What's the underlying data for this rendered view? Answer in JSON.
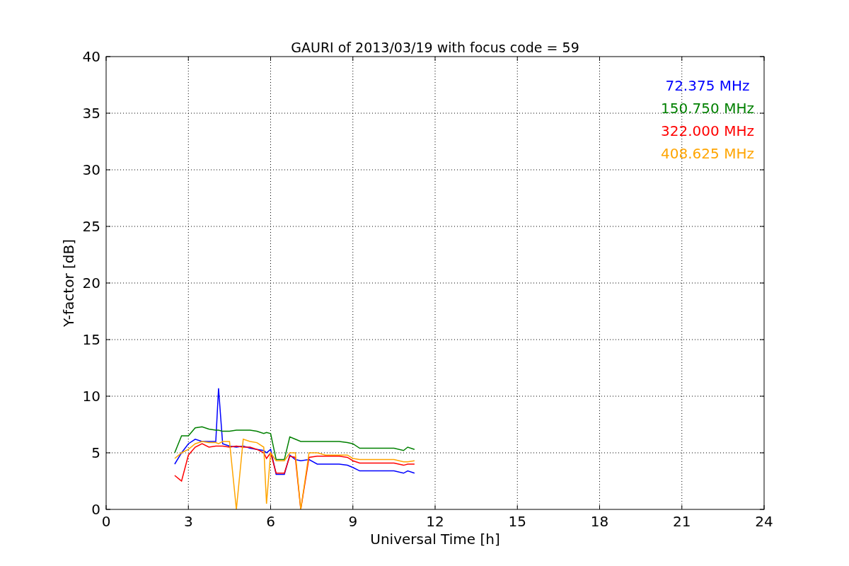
{
  "chart_data": {
    "type": "line",
    "title": "GAURI of 2013/03/19 with focus code = 59",
    "xlabel": "Universal Time [h]",
    "ylabel": "Y-factor [dB]",
    "x": [
      2.5,
      2.75,
      3,
      3.25,
      3.5,
      3.75,
      4,
      4.1,
      4.25,
      4.5,
      4.75,
      5,
      5.25,
      5.5,
      5.75,
      5.85,
      6,
      6.2,
      6.5,
      6.7,
      6.9,
      7.1,
      7.4,
      7.7,
      8,
      8.5,
      8.8,
      9,
      9.25,
      9.5,
      10,
      10.5,
      10.85,
      11,
      11.25
    ],
    "series": [
      {
        "name": "72.375 MHz",
        "color": "#0000ff",
        "values": [
          4,
          5,
          5.8,
          6.2,
          6,
          6,
          6,
          10.7,
          5.8,
          5.6,
          5.5,
          5.6,
          5.4,
          5.3,
          5.2,
          5,
          5.3,
          3.1,
          3.1,
          4.8,
          4.4,
          4.3,
          4.4,
          4,
          4,
          4,
          3.9,
          3.7,
          3.4,
          3.4,
          3.4,
          3.4,
          3.2,
          3.4,
          3.2
        ]
      },
      {
        "name": "150.750 MHz",
        "color": "#008000",
        "values": [
          5,
          6.5,
          6.5,
          7.2,
          7.3,
          7.1,
          7,
          7,
          6.9,
          6.9,
          7,
          7,
          7,
          6.9,
          6.7,
          6.8,
          6.7,
          4.4,
          4.4,
          6.4,
          6.2,
          6,
          6,
          6,
          6,
          6,
          5.9,
          5.8,
          5.4,
          5.4,
          5.4,
          5.4,
          5.2,
          5.5,
          5.3
        ]
      },
      {
        "name": "322.000 MHz",
        "color": "#ff0000",
        "values": [
          3,
          2.5,
          4.8,
          5.5,
          5.8,
          5.5,
          5.6,
          5.6,
          5.6,
          5.5,
          5.6,
          5.5,
          5.5,
          5.3,
          5,
          4.5,
          5,
          3.2,
          3.2,
          4.7,
          4.6,
          0,
          4.6,
          4.7,
          4.7,
          4.7,
          4.6,
          4.3,
          4.1,
          4.1,
          4.1,
          4.1,
          3.9,
          4,
          4
        ]
      },
      {
        "name": "408.625 MHz",
        "color": "#ffa500",
        "values": [
          4.5,
          5,
          5.3,
          5.8,
          6,
          5.9,
          5.9,
          5.8,
          6,
          6,
          0,
          6.2,
          6,
          5.9,
          5.5,
          0.5,
          5,
          4.3,
          4.3,
          5,
          5,
          0,
          5,
          5,
          4.8,
          4.8,
          4.8,
          4.5,
          4.4,
          4.4,
          4.4,
          4.4,
          4.2,
          4.2,
          4.3
        ]
      }
    ],
    "xlim": [
      0,
      24
    ],
    "ylim": [
      0,
      40
    ],
    "xticks": [
      0,
      3,
      6,
      9,
      12,
      15,
      18,
      21,
      24
    ],
    "yticks": [
      0,
      5,
      10,
      15,
      20,
      25,
      30,
      35,
      40
    ],
    "grid": true
  }
}
